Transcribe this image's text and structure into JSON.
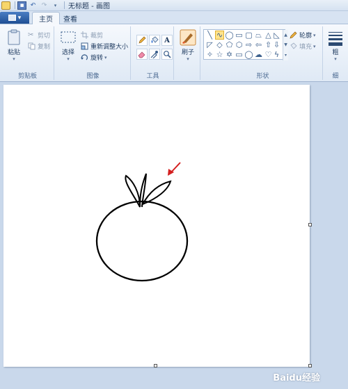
{
  "window": {
    "title": "无标题 - 画图"
  },
  "tabs": [
    "主页",
    "查看"
  ],
  "groups": {
    "clipboard": {
      "label": "剪贴板",
      "paste": "粘贴",
      "cut": "剪切",
      "copy": "复制"
    },
    "image": {
      "label": "图像",
      "select": "选择",
      "crop": "裁剪",
      "resize": "重新调整大小",
      "rotate": "旋转"
    },
    "tools": {
      "label": "工具"
    },
    "brushes": {
      "label": "刷子"
    },
    "shapes": {
      "label": "形状",
      "outline": "轮廓",
      "fill": "填充"
    },
    "size": {
      "label": "粗",
      "sublabel": "细"
    }
  },
  "watermark": {
    "text": "Baidu经验"
  },
  "colors": {
    "arrow": "#d42020",
    "stroke": "#000000",
    "selected_shape": "#ffe38c"
  }
}
